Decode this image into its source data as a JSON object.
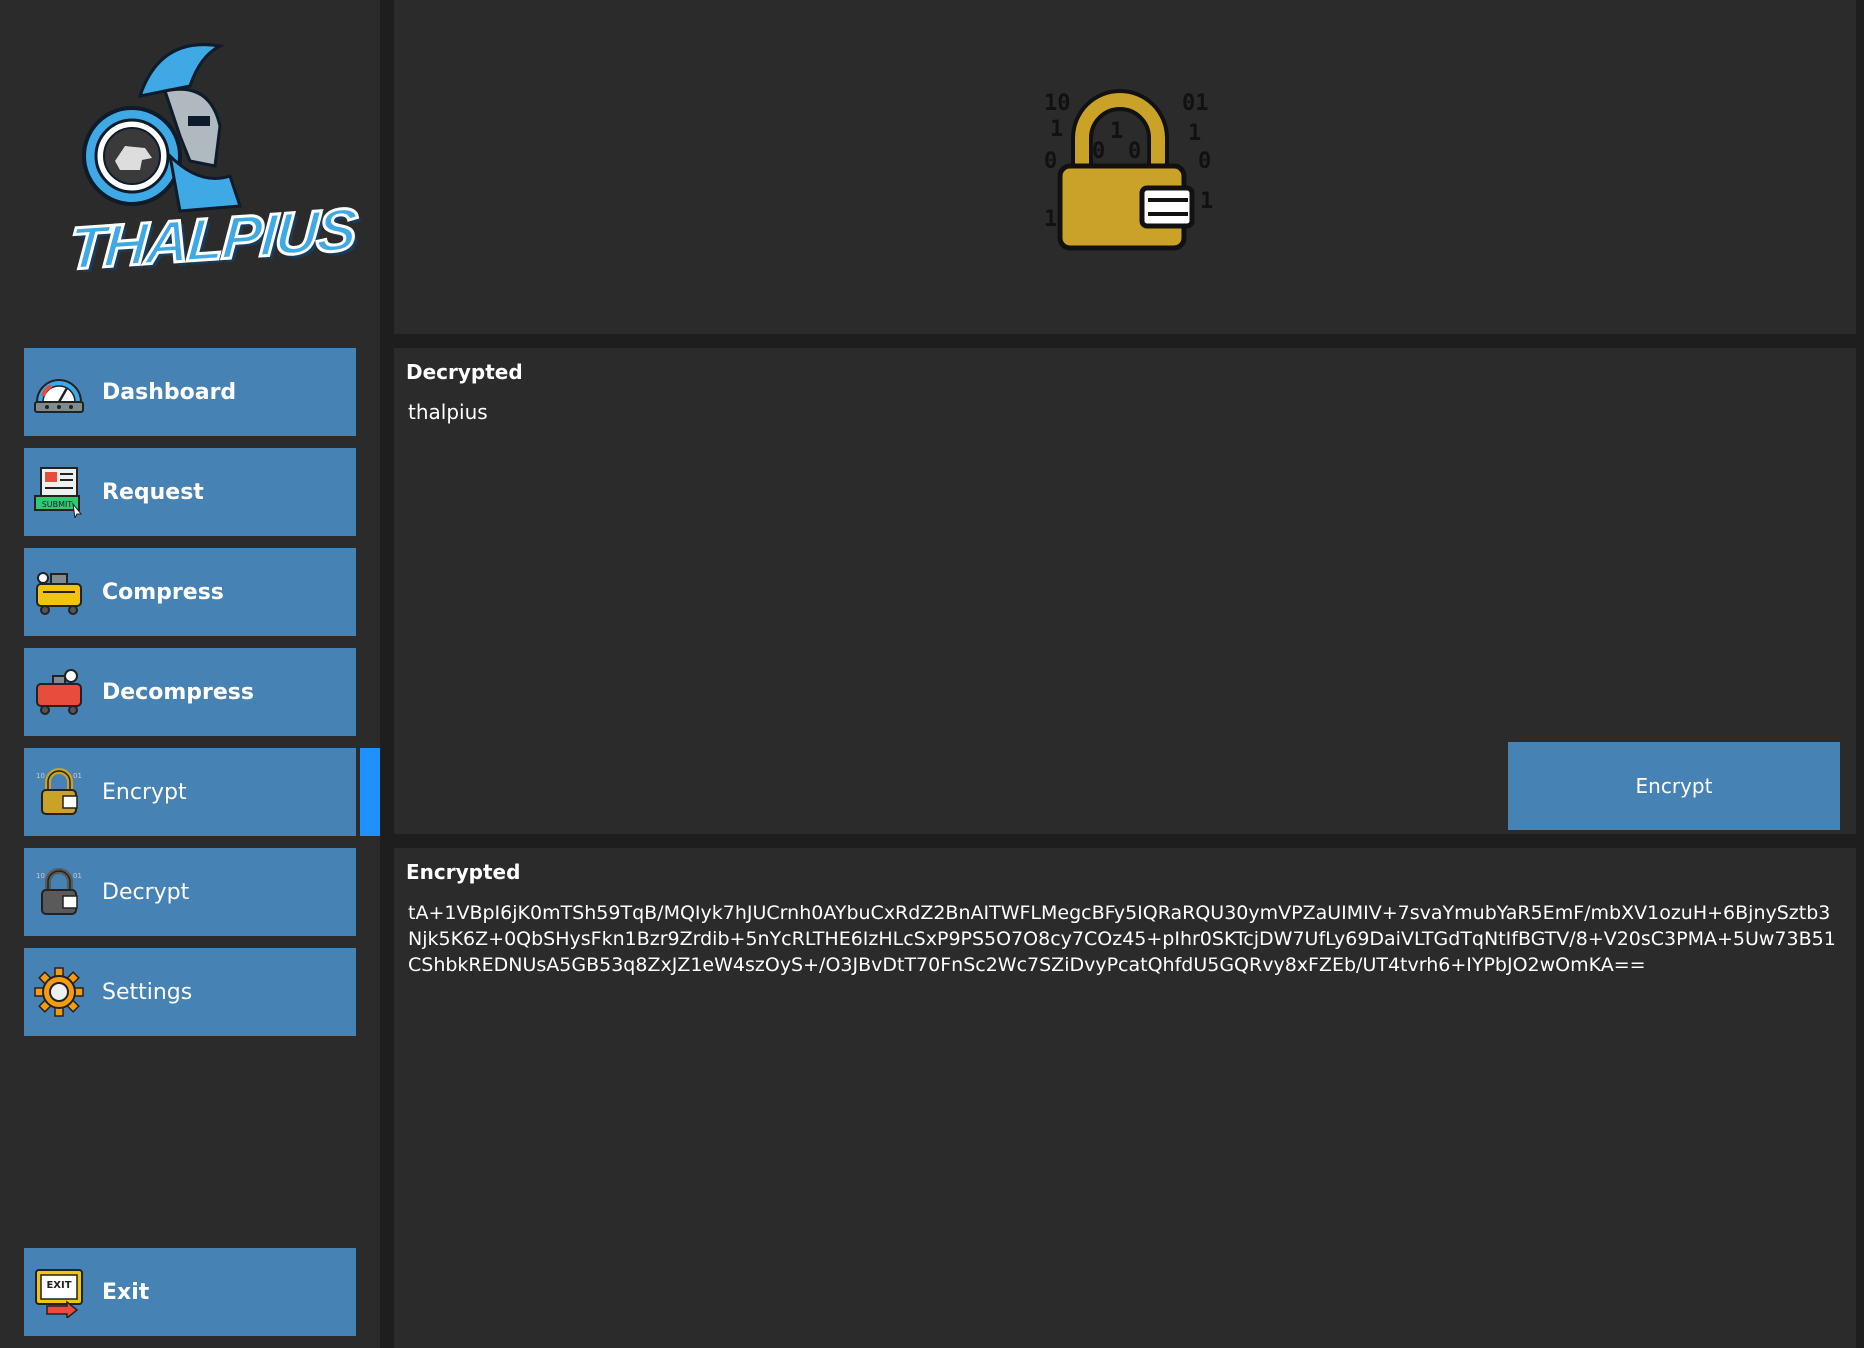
{
  "app": {
    "logo_text": "THALPIUS"
  },
  "sidebar": {
    "items": [
      {
        "label": "Dashboard",
        "icon": "dashboard-gauge-icon"
      },
      {
        "label": "Request",
        "icon": "submit-form-icon"
      },
      {
        "label": "Compress",
        "icon": "compressor-icon"
      },
      {
        "label": "Decompress",
        "icon": "decompressor-icon"
      },
      {
        "label": "Encrypt",
        "icon": "encrypt-lock-icon",
        "active": true
      },
      {
        "label": "Decrypt",
        "icon": "decrypt-lock-icon"
      },
      {
        "label": "Settings",
        "icon": "gear-icon"
      }
    ],
    "exit_label": "Exit",
    "exit_icon": "exit-sign-icon"
  },
  "header": {
    "icon": "binary-padlock-icon"
  },
  "decrypted": {
    "label": "Decrypted",
    "value": "thalpius"
  },
  "actions": {
    "encrypt_label": "Encrypt"
  },
  "encrypted": {
    "label": "Encrypted",
    "value": "tA+1VBpI6jK0mTSh59TqB/MQIyk7hJUCrnh0AYbuCxRdZ2BnAITWFLMegcBFy5IQRaRQU30ymVPZaUIMIV+7svaYmubYaR5EmF/mbXV1ozuH+6BjnySztb3Njk5K6Z+0QbSHysFkn1Bzr9Zrdib+5nYcRLTHE6IzHLcSxP9PS5O7O8cy7COz45+pIhr0SKTcjDW7UfLy69DaiVLTGdTqNtIfBGTV/8+V20sC3PMA+5Uw73B51CShbkREDNUsA5GB53q8ZxJZ1eW4szOyS+/O3JBvDtT70FnSc2Wc7SZiDvyPcatQhfdU5GQRvy8xFZEb/UT4tvrh6+IYPbJO2wOmKA=="
  },
  "colors": {
    "background": "#1e1e1e",
    "panel": "#2b2b2b",
    "button": "#4682b4",
    "active_marker": "#1e90ff",
    "lock_gold": "#c9a227"
  }
}
